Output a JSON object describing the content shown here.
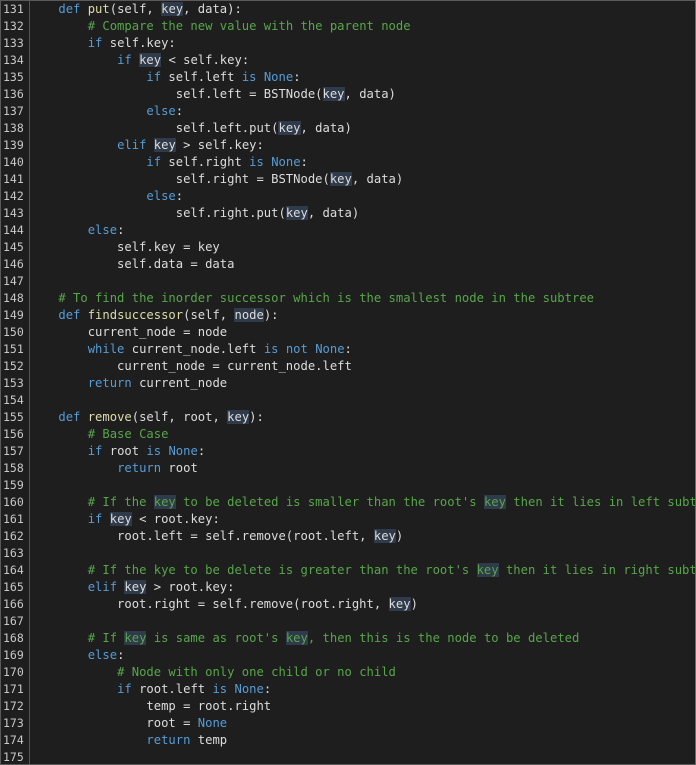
{
  "editor": {
    "colors": {
      "background": "#1e1e1e",
      "keyword": "#569cd6",
      "function": "#dcdcaa",
      "comment": "#57a64a",
      "text": "#dcdcdc",
      "highlight": "#2f3a4a"
    },
    "lines": [
      {
        "n": "131",
        "tokens": [
          [
            "    ",
            ""
          ],
          [
            "def",
            "kw"
          ],
          [
            " ",
            ""
          ],
          [
            "put",
            "fn"
          ],
          [
            "(self, ",
            ""
          ],
          [
            "key",
            "hl"
          ],
          [
            ", data):",
            ""
          ]
        ]
      },
      {
        "n": "132",
        "tokens": [
          [
            "        ",
            ""
          ],
          [
            "# Compare the new value with the parent node",
            "cm"
          ]
        ]
      },
      {
        "n": "133",
        "tokens": [
          [
            "        ",
            ""
          ],
          [
            "if",
            "kw"
          ],
          [
            " self.key:",
            ""
          ]
        ]
      },
      {
        "n": "134",
        "tokens": [
          [
            "            ",
            ""
          ],
          [
            "if",
            "kw"
          ],
          [
            " ",
            ""
          ],
          [
            "key",
            "hl"
          ],
          [
            " < self.key:",
            ""
          ]
        ]
      },
      {
        "n": "135",
        "tokens": [
          [
            "                ",
            ""
          ],
          [
            "if",
            "kw"
          ],
          [
            " self.left ",
            ""
          ],
          [
            "is",
            "kw"
          ],
          [
            " ",
            ""
          ],
          [
            "None",
            "kw"
          ],
          [
            ":",
            ""
          ]
        ]
      },
      {
        "n": "136",
        "tokens": [
          [
            "                    self.left = BSTNode(",
            ""
          ],
          [
            "key",
            "hl"
          ],
          [
            ", data)",
            ""
          ]
        ]
      },
      {
        "n": "137",
        "tokens": [
          [
            "                ",
            ""
          ],
          [
            "else",
            "kw"
          ],
          [
            ":",
            ""
          ]
        ]
      },
      {
        "n": "138",
        "tokens": [
          [
            "                    self.left.put(",
            ""
          ],
          [
            "key",
            "hl"
          ],
          [
            ", data)",
            ""
          ]
        ]
      },
      {
        "n": "139",
        "tokens": [
          [
            "            ",
            ""
          ],
          [
            "elif",
            "kw"
          ],
          [
            " ",
            ""
          ],
          [
            "key",
            "hl"
          ],
          [
            " > self.key:",
            ""
          ]
        ]
      },
      {
        "n": "140",
        "tokens": [
          [
            "                ",
            ""
          ],
          [
            "if",
            "kw"
          ],
          [
            " self.right ",
            ""
          ],
          [
            "is",
            "kw"
          ],
          [
            " ",
            ""
          ],
          [
            "None",
            "kw"
          ],
          [
            ":",
            ""
          ]
        ]
      },
      {
        "n": "141",
        "tokens": [
          [
            "                    self.right = BSTNode(",
            ""
          ],
          [
            "key",
            "hl"
          ],
          [
            ", data)",
            ""
          ]
        ]
      },
      {
        "n": "142",
        "tokens": [
          [
            "                ",
            ""
          ],
          [
            "else",
            "kw"
          ],
          [
            ":",
            ""
          ]
        ]
      },
      {
        "n": "143",
        "tokens": [
          [
            "                    self.right.put(",
            ""
          ],
          [
            "key",
            "hl"
          ],
          [
            ", data)",
            ""
          ]
        ]
      },
      {
        "n": "144",
        "tokens": [
          [
            "        ",
            ""
          ],
          [
            "else",
            "kw"
          ],
          [
            ":",
            ""
          ]
        ]
      },
      {
        "n": "145",
        "tokens": [
          [
            "            self.key = key",
            ""
          ]
        ]
      },
      {
        "n": "146",
        "tokens": [
          [
            "            self.data = data",
            ""
          ]
        ]
      },
      {
        "n": "147",
        "tokens": []
      },
      {
        "n": "148",
        "tokens": [
          [
            "    ",
            ""
          ],
          [
            "# To find the inorder successor which is the smallest node in the subtree",
            "cm"
          ]
        ]
      },
      {
        "n": "149",
        "tokens": [
          [
            "    ",
            ""
          ],
          [
            "def",
            "kw"
          ],
          [
            " ",
            ""
          ],
          [
            "findsuccessor",
            "fn"
          ],
          [
            "(self, ",
            ""
          ],
          [
            "node",
            "hl"
          ],
          [
            "):",
            ""
          ]
        ]
      },
      {
        "n": "150",
        "tokens": [
          [
            "        current_node = node",
            ""
          ]
        ]
      },
      {
        "n": "151",
        "tokens": [
          [
            "        ",
            ""
          ],
          [
            "while",
            "kw"
          ],
          [
            " current_node.left ",
            ""
          ],
          [
            "is not",
            "kw"
          ],
          [
            " ",
            ""
          ],
          [
            "None",
            "kw"
          ],
          [
            ":",
            ""
          ]
        ]
      },
      {
        "n": "152",
        "tokens": [
          [
            "            current_node = current_node.left",
            ""
          ]
        ]
      },
      {
        "n": "153",
        "tokens": [
          [
            "        ",
            ""
          ],
          [
            "return",
            "kw"
          ],
          [
            " current_node",
            ""
          ]
        ]
      },
      {
        "n": "154",
        "tokens": []
      },
      {
        "n": "155",
        "tokens": [
          [
            "    ",
            ""
          ],
          [
            "def",
            "kw"
          ],
          [
            " ",
            ""
          ],
          [
            "remove",
            "fn"
          ],
          [
            "(self, root, ",
            ""
          ],
          [
            "key",
            "hl"
          ],
          [
            "):",
            ""
          ]
        ]
      },
      {
        "n": "156",
        "tokens": [
          [
            "        ",
            ""
          ],
          [
            "# Base Case",
            "cm"
          ]
        ]
      },
      {
        "n": "157",
        "tokens": [
          [
            "        ",
            ""
          ],
          [
            "if",
            "kw"
          ],
          [
            " root ",
            ""
          ],
          [
            "is",
            "kw"
          ],
          [
            " ",
            ""
          ],
          [
            "None",
            "kw"
          ],
          [
            ":",
            ""
          ]
        ]
      },
      {
        "n": "158",
        "tokens": [
          [
            "            ",
            ""
          ],
          [
            "return",
            "kw"
          ],
          [
            " root",
            ""
          ]
        ]
      },
      {
        "n": "159",
        "tokens": []
      },
      {
        "n": "160",
        "tokens": [
          [
            "        ",
            ""
          ],
          [
            "# If the ",
            "cm"
          ],
          [
            "key",
            "hlcm"
          ],
          [
            " to be deleted is smaller than the root's ",
            "cm"
          ],
          [
            "key",
            "hlcm"
          ],
          [
            " then it lies in left subtree",
            "cm"
          ]
        ]
      },
      {
        "n": "161",
        "tokens": [
          [
            "        ",
            ""
          ],
          [
            "if",
            "kw"
          ],
          [
            " ",
            ""
          ],
          [
            "key",
            "hl"
          ],
          [
            " < root.key:",
            ""
          ]
        ]
      },
      {
        "n": "162",
        "tokens": [
          [
            "            root.left = self.remove(root.left, ",
            ""
          ],
          [
            "key",
            "hl"
          ],
          [
            ")",
            ""
          ]
        ]
      },
      {
        "n": "163",
        "tokens": []
      },
      {
        "n": "164",
        "tokens": [
          [
            "        ",
            ""
          ],
          [
            "# If the kye to be delete is greater than the root's ",
            "cm"
          ],
          [
            "key",
            "hlcm"
          ],
          [
            " then it lies in right subtree",
            "cm"
          ]
        ]
      },
      {
        "n": "165",
        "tokens": [
          [
            "        ",
            ""
          ],
          [
            "elif",
            "kw"
          ],
          [
            " ",
            ""
          ],
          [
            "key",
            "hl"
          ],
          [
            " > root.key:",
            ""
          ]
        ]
      },
      {
        "n": "166",
        "tokens": [
          [
            "            root.right = self.remove(root.right, ",
            ""
          ],
          [
            "key",
            "hl"
          ],
          [
            ")",
            ""
          ]
        ]
      },
      {
        "n": "167",
        "tokens": []
      },
      {
        "n": "168",
        "tokens": [
          [
            "        ",
            ""
          ],
          [
            "# If ",
            "cm"
          ],
          [
            "key",
            "hlcm"
          ],
          [
            " is same as root's ",
            "cm"
          ],
          [
            "key",
            "hlcm"
          ],
          [
            ", then this is the node to be deleted",
            "cm"
          ]
        ]
      },
      {
        "n": "169",
        "tokens": [
          [
            "        ",
            ""
          ],
          [
            "else",
            "kw"
          ],
          [
            ":",
            ""
          ]
        ]
      },
      {
        "n": "170",
        "tokens": [
          [
            "            ",
            ""
          ],
          [
            "# Node with only one child or no child",
            "cm"
          ]
        ]
      },
      {
        "n": "171",
        "tokens": [
          [
            "            ",
            ""
          ],
          [
            "if",
            "kw"
          ],
          [
            " root.left ",
            ""
          ],
          [
            "is",
            "kw"
          ],
          [
            " ",
            ""
          ],
          [
            "None",
            "kw"
          ],
          [
            ":",
            ""
          ]
        ]
      },
      {
        "n": "172",
        "tokens": [
          [
            "                temp = root.right",
            ""
          ]
        ]
      },
      {
        "n": "173",
        "tokens": [
          [
            "                root = ",
            ""
          ],
          [
            "None",
            "kw"
          ]
        ]
      },
      {
        "n": "174",
        "tokens": [
          [
            "                ",
            ""
          ],
          [
            "return",
            "kw"
          ],
          [
            " temp",
            ""
          ]
        ]
      },
      {
        "n": "175",
        "tokens": []
      }
    ]
  }
}
